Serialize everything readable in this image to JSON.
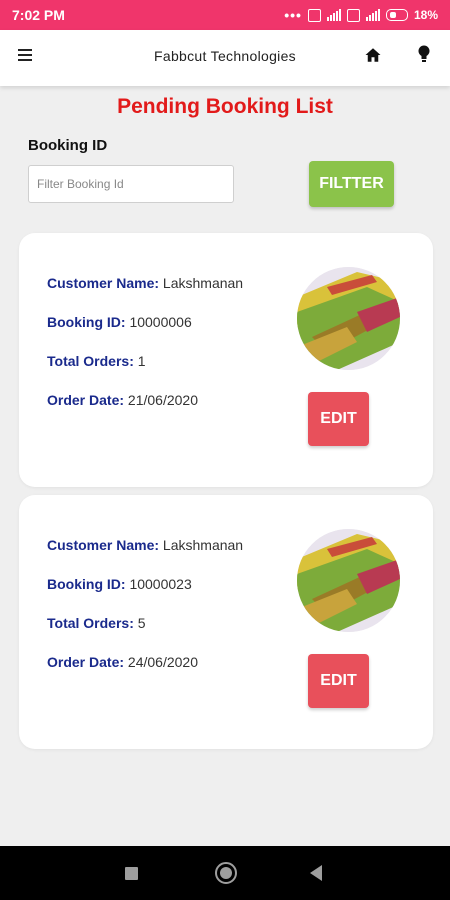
{
  "status_bar": {
    "time": "7:02 PM",
    "battery": "18%"
  },
  "app_bar": {
    "title": "Fabbcut Technologies"
  },
  "page": {
    "title": "Pending Booking List"
  },
  "filter": {
    "label": "Booking ID",
    "placeholder": "Filter Booking Id",
    "button_label": "FILTTER"
  },
  "labels": {
    "customer_name": "Customer Name:",
    "booking_id": "Booking ID:",
    "total_orders": "Total Orders:",
    "order_date": "Order Date:"
  },
  "bookings": [
    {
      "customer_name": "Lakshmanan",
      "booking_id": "10000006",
      "total_orders": "1",
      "order_date": "21/06/2020",
      "edit_label": "EDIT"
    },
    {
      "customer_name": "Lakshmanan",
      "booking_id": "10000023",
      "total_orders": "5",
      "order_date": "24/06/2020",
      "edit_label": "EDIT"
    }
  ],
  "colors": {
    "status_bar": "#f0356b",
    "title_red": "#e21a1a",
    "label_blue": "#1a2a8c",
    "filter_green": "#8bc34a",
    "edit_red": "#e8505b"
  },
  "icons": [
    "menu-icon",
    "home-icon",
    "lightbulb-icon"
  ]
}
